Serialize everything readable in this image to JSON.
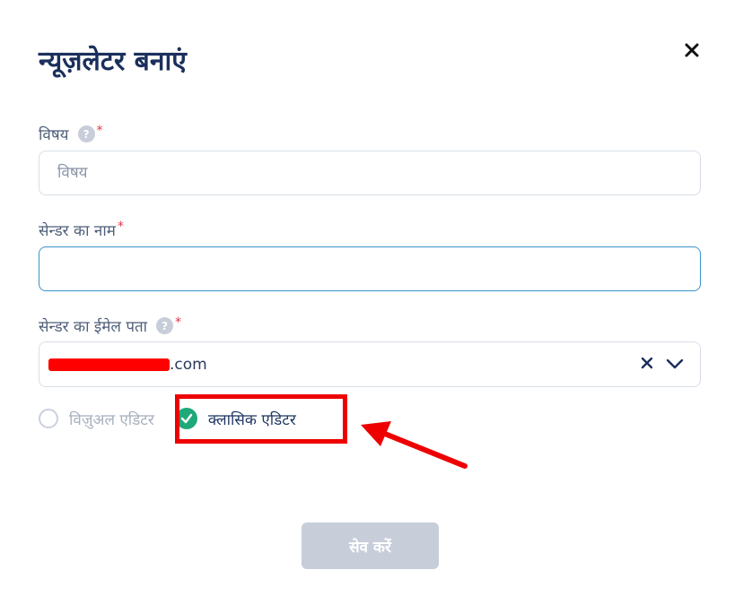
{
  "header": {
    "title": "न्यूज़लेटर बनाएं"
  },
  "fields": {
    "subject_label": "विषय",
    "subject_placeholder": "विषय",
    "subject_value": "",
    "sender_name_label": "सेन्डर का नाम",
    "sender_name_value": "",
    "sender_email_label": "सेन्डर का ईमेल पता",
    "sender_email_suffix": ".com",
    "required_mark": "*",
    "help_glyph": "?"
  },
  "editor": {
    "visual_label": "विज़ुअल एडिटर",
    "classic_label": "क्लासिक एडिटर",
    "selected": "classic"
  },
  "footer": {
    "save_label": "सेव करें"
  },
  "colors": {
    "title": "#1b2f5c",
    "required": "#e0364b",
    "focus_border": "#3a94c9",
    "check_green": "#1fa97a",
    "annotation_red": "#ee0000",
    "disabled_button": "#c7ced9"
  },
  "icons": [
    "close-icon",
    "help-icon",
    "clear-icon",
    "chevron-down-icon",
    "check-icon",
    "arrow-annotation"
  ]
}
